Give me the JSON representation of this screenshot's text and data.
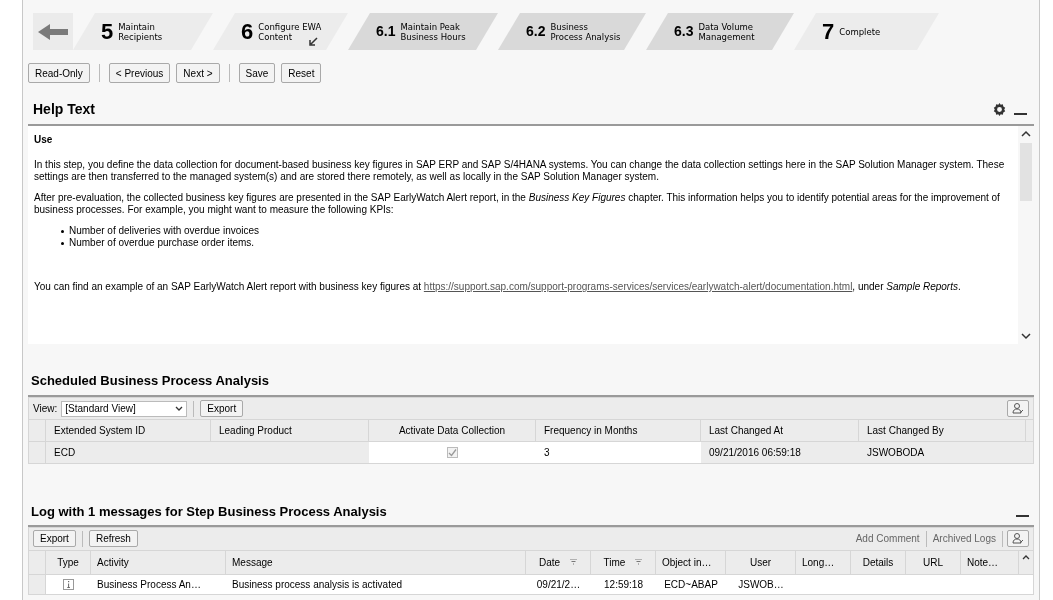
{
  "steps": [
    {
      "number": "5",
      "label": "Maintain Recipients",
      "kind": "main"
    },
    {
      "number": "6",
      "label": "Configure EWA Content",
      "kind": "main"
    },
    {
      "number": "6.1",
      "label": "Maintain Peak Business Hours",
      "kind": "sub"
    },
    {
      "number": "6.2",
      "label": "Business Process Analysis",
      "kind": "sub"
    },
    {
      "number": "6.3",
      "label": "Data Volume Management",
      "kind": "sub"
    },
    {
      "number": "7",
      "label": "Complete",
      "kind": "main"
    }
  ],
  "toolbar": [
    [
      "Read-Only"
    ],
    [
      "< Previous",
      "Next >"
    ],
    [
      "Save",
      "Reset"
    ]
  ],
  "help": {
    "title": "Help Text",
    "heading": "Use",
    "paragraphs": [
      "In this step, you define the data collection for document-based business key figures in SAP ERP and SAP S/4HANA systems. You can change the data collection settings here in the SAP Solution Manager system. These settings are then transferred to the managed system(s) and are stored there remotely, as well as locally in the SAP Solution Manager system.",
      "After pre-evaluation, the collected business key figures are presented in the SAP EarlyWatch Alert report, in the *Business Key Figures* chapter. This information helps you to identify potential areas for the improvement of business processes. For example, you might want to measure the following KPIs:"
    ],
    "bullets": [
      "Number of deliveries with overdue invoices",
      "Number of overdue purchase order items."
    ],
    "link_sentence": {
      "before": "You can find an example of an SAP EarlyWatch Alert report with business key figures at",
      "link": "https://support.sap.com/support-programs-services/services/earlywatch-alert/documentation.html",
      "after": ", under *Sample Reports*."
    }
  },
  "scheduled": {
    "title": "Scheduled Business Process Analysis",
    "view_label": "View:",
    "view": "[Standard View]",
    "export": "Export",
    "columns": [
      "Extended System ID",
      "Leading Product",
      "Activate Data Collection",
      "Frequency in Months",
      "Last Changed At",
      "Last Changed By"
    ],
    "rows": [
      {
        "system": "ECD",
        "product": "",
        "activate": true,
        "frequency": "3",
        "changed_at": "09/21/2016 06:59:18",
        "changed_by": "JSWOBODA"
      }
    ]
  },
  "log": {
    "title": "Log with 1 messages for Step Business Process Analysis",
    "export": "Export",
    "refresh": "Refresh",
    "add_comment": "Add Comment",
    "archived_logs": "Archived Logs",
    "columns": [
      {
        "label": "Type",
        "filter": false
      },
      {
        "label": "Activity",
        "filter": false
      },
      {
        "label": "Message",
        "filter": false
      },
      {
        "label": "Date",
        "filter": true
      },
      {
        "label": "Time",
        "filter": true
      },
      {
        "label": "Object in…",
        "filter": false
      },
      {
        "label": "User",
        "filter": false
      },
      {
        "label": "Long…",
        "filter": false
      },
      {
        "label": "Details",
        "filter": false
      },
      {
        "label": "URL",
        "filter": false
      },
      {
        "label": "Note…",
        "filter": false
      }
    ],
    "rows": [
      {
        "kind": "info",
        "cells": [
          "",
          "Business Process An…",
          "Business process analysis is activated",
          "09/21/2…",
          "12:59:18",
          "ECD~ABAP",
          "JSWOB…"
        ]
      }
    ]
  }
}
